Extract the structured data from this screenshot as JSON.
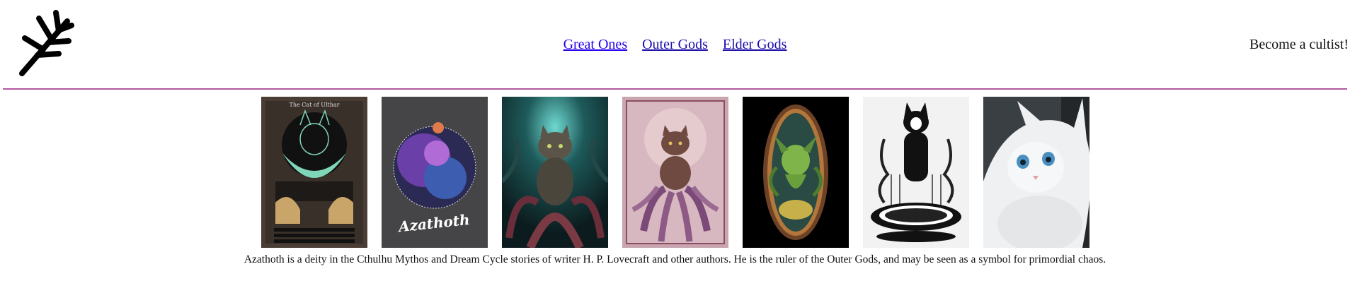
{
  "nav": {
    "links": [
      {
        "label": "Great Ones"
      },
      {
        "label": "Outer Gods"
      },
      {
        "label": "Elder Gods"
      }
    ]
  },
  "header": {
    "cta_label": "Become a cultist!",
    "logo_icon": "branch-logo-icon"
  },
  "gallery": {
    "items": [
      {
        "art_text": "The Cat of Ulthar"
      },
      {
        "art_text": "Azathoth"
      },
      {
        "art_text": ""
      },
      {
        "art_text": ""
      },
      {
        "art_text": ""
      },
      {
        "art_text": ""
      },
      {
        "art_text": ""
      }
    ]
  },
  "caption": "Azathoth is a deity in the Cthulhu Mythos and Dream Cycle stories of writer H. P. Lovecraft and other authors. He is the ruler of the Outer Gods, and may be seen as a symbol for primordial chaos.",
  "colors": {
    "divider": "#b5579e",
    "link": "#1a0dab"
  }
}
